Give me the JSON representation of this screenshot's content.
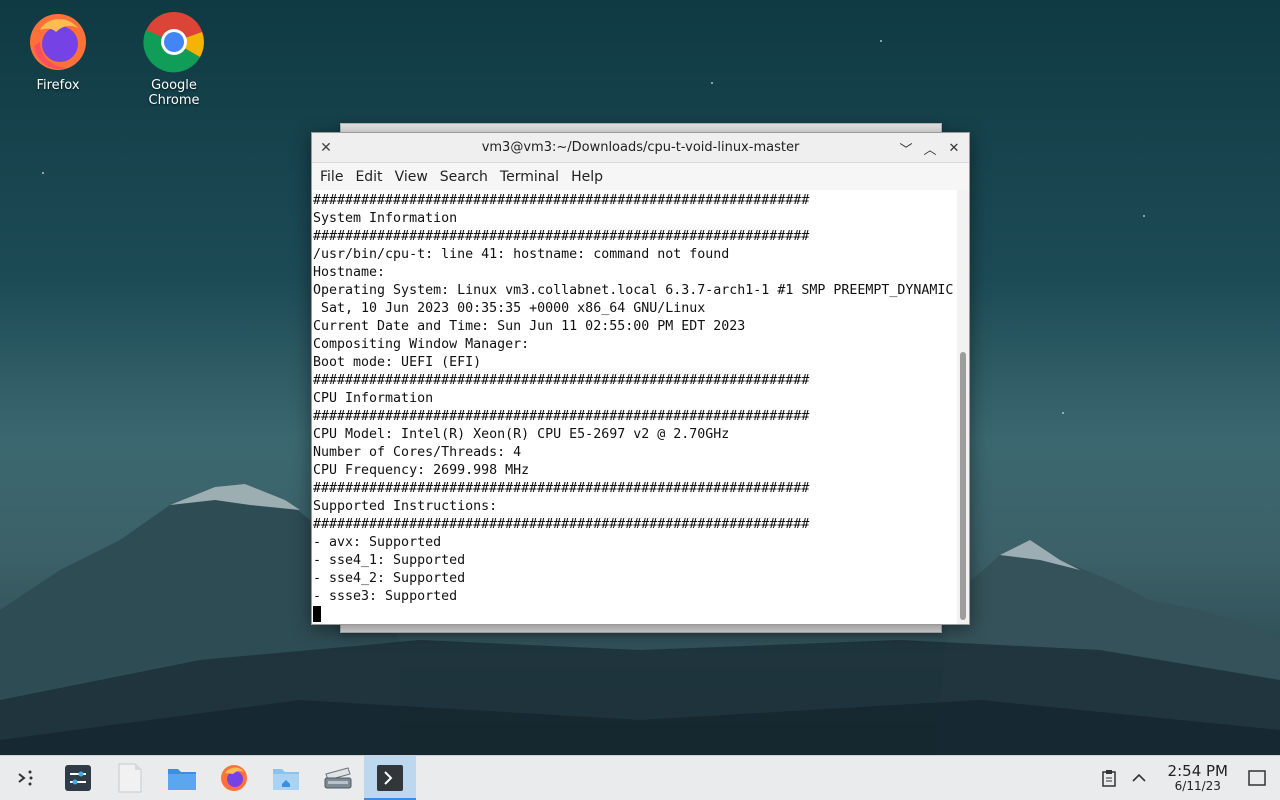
{
  "desktop": {
    "icons": [
      {
        "label": "Firefox",
        "icon": "firefox-icon"
      },
      {
        "label": "Google Chrome",
        "icon": "chrome-icon"
      }
    ]
  },
  "terminal": {
    "title": "vm3@vm3:~/Downloads/cpu-t-void-linux-master",
    "menu": [
      "File",
      "Edit",
      "View",
      "Search",
      "Terminal",
      "Help"
    ],
    "lines": [
      "##############################################################",
      "System Information",
      "##############################################################",
      "/usr/bin/cpu-t: line 41: hostname: command not found",
      "Hostname:",
      "Operating System: Linux vm3.collabnet.local 6.3.7-arch1-1 #1 SMP PREEMPT_DYNAMIC",
      " Sat, 10 Jun 2023 00:35:35 +0000 x86_64 GNU/Linux",
      "Current Date and Time: Sun Jun 11 02:55:00 PM EDT 2023",
      "Compositing Window Manager:",
      "Boot mode: UEFI (EFI)",
      "##############################################################",
      "CPU Information",
      "##############################################################",
      "CPU Model: Intel(R) Xeon(R) CPU E5-2697 v2 @ 2.70GHz",
      "Number of Cores/Threads: 4",
      "CPU Frequency: 2699.998 MHz",
      "##############################################################",
      "Supported Instructions:",
      "##############################################################",
      "- avx: Supported",
      "- sse4_1: Supported",
      "- sse4_2: Supported",
      "- ssse3: Supported"
    ]
  },
  "taskbar": {
    "items": [
      {
        "icon": "app-launcher-icon"
      },
      {
        "icon": "system-settings-icon"
      },
      {
        "icon": "text-file-icon"
      },
      {
        "icon": "file-manager-icon"
      },
      {
        "icon": "firefox-icon"
      },
      {
        "icon": "home-folder-icon"
      },
      {
        "icon": "scanner-icon"
      },
      {
        "icon": "terminal-icon",
        "active": true
      }
    ],
    "clock": {
      "time": "2:54 PM",
      "date": "6/11/23"
    }
  },
  "colors": {
    "accent": "#3d8ee0",
    "taskbar": "#e9ebed"
  }
}
